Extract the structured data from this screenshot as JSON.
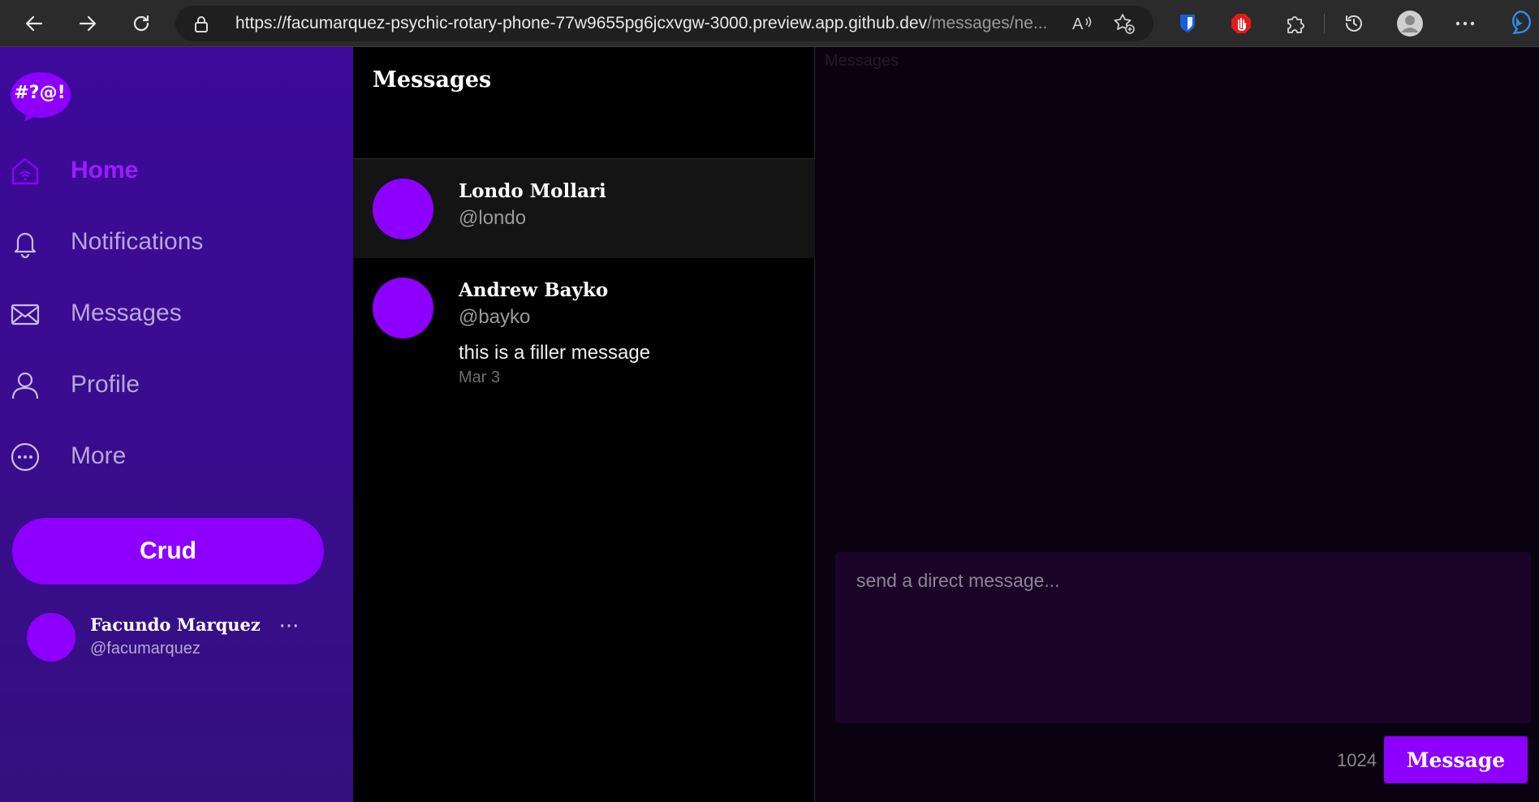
{
  "browser": {
    "url_main": "https://facumarquez-psychic-rotary-phone-77w9655pg6jcxvgw-3000.preview.app.github.dev",
    "url_path": "/messages/ne..."
  },
  "sidebar": {
    "logo_text": "#?@!",
    "items": [
      {
        "label": "Home",
        "icon": "home-icon",
        "active": true
      },
      {
        "label": "Notifications",
        "icon": "bell-icon",
        "active": false
      },
      {
        "label": "Messages",
        "icon": "envelope-icon",
        "active": false
      },
      {
        "label": "Profile",
        "icon": "person-icon",
        "active": false
      },
      {
        "label": "More",
        "icon": "more-circle-icon",
        "active": false
      }
    ],
    "crud_label": "Crud",
    "user": {
      "name": "Facundo Marquez",
      "handle": "@facumarquez",
      "more": "···"
    }
  },
  "messages_list": {
    "title": "Messages",
    "conversations": [
      {
        "name": "Londo Mollari",
        "handle": "@londo",
        "preview": "",
        "date": "",
        "selected": true
      },
      {
        "name": "Andrew Bayko",
        "handle": "@bayko",
        "preview": "this is a filler message",
        "date": "Mar 3",
        "selected": false
      }
    ]
  },
  "chat": {
    "header_ghost": "Messages",
    "input_placeholder": "send a direct message...",
    "char_count": "1024",
    "send_label": "Message"
  },
  "colors": {
    "accent": "#8d00ff",
    "sidebar_bg": "#3d0a9a",
    "active_nav": "#9b1cff",
    "list_bg": "#000000",
    "chat_bg": "#0a0210",
    "input_bg": "#1a0428"
  }
}
